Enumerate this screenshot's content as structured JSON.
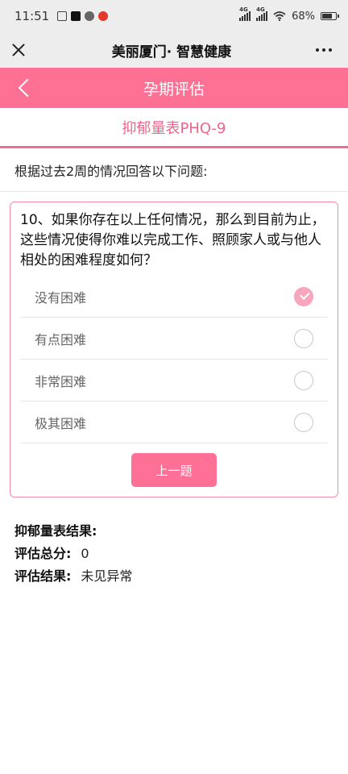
{
  "status_bar": {
    "time": "11:51",
    "network1": "4G",
    "network2": "4G",
    "battery": "68%",
    "battery_level": 0.68
  },
  "header": {
    "title": "美丽厦门· 智慧健康"
  },
  "app_bar": {
    "title": "孕期评估"
  },
  "scale": {
    "name": "抑郁量表PHQ-9"
  },
  "instruction": "根据过去2周的情况回答以下问题:",
  "question": {
    "text": "10、如果你存在以上任何情况，那么到目前为止，这些情况使得你难以完成工作、照顾家人或与他人相处的困难程度如何？",
    "options": [
      {
        "label": "没有困难",
        "selected": true
      },
      {
        "label": "有点困难",
        "selected": false
      },
      {
        "label": "非常困难",
        "selected": false
      },
      {
        "label": "极其困难",
        "selected": false
      }
    ],
    "prev_button": "上一题"
  },
  "result": {
    "title": "抑郁量表结果:",
    "score_label": "评估总分:",
    "score_value": "0",
    "outcome_label": "评估结果:",
    "outcome_value": "未见异常"
  },
  "colors": {
    "accent": "#ff7095",
    "subtitle_text": "#f0638b",
    "check": "#f7a6bd"
  }
}
